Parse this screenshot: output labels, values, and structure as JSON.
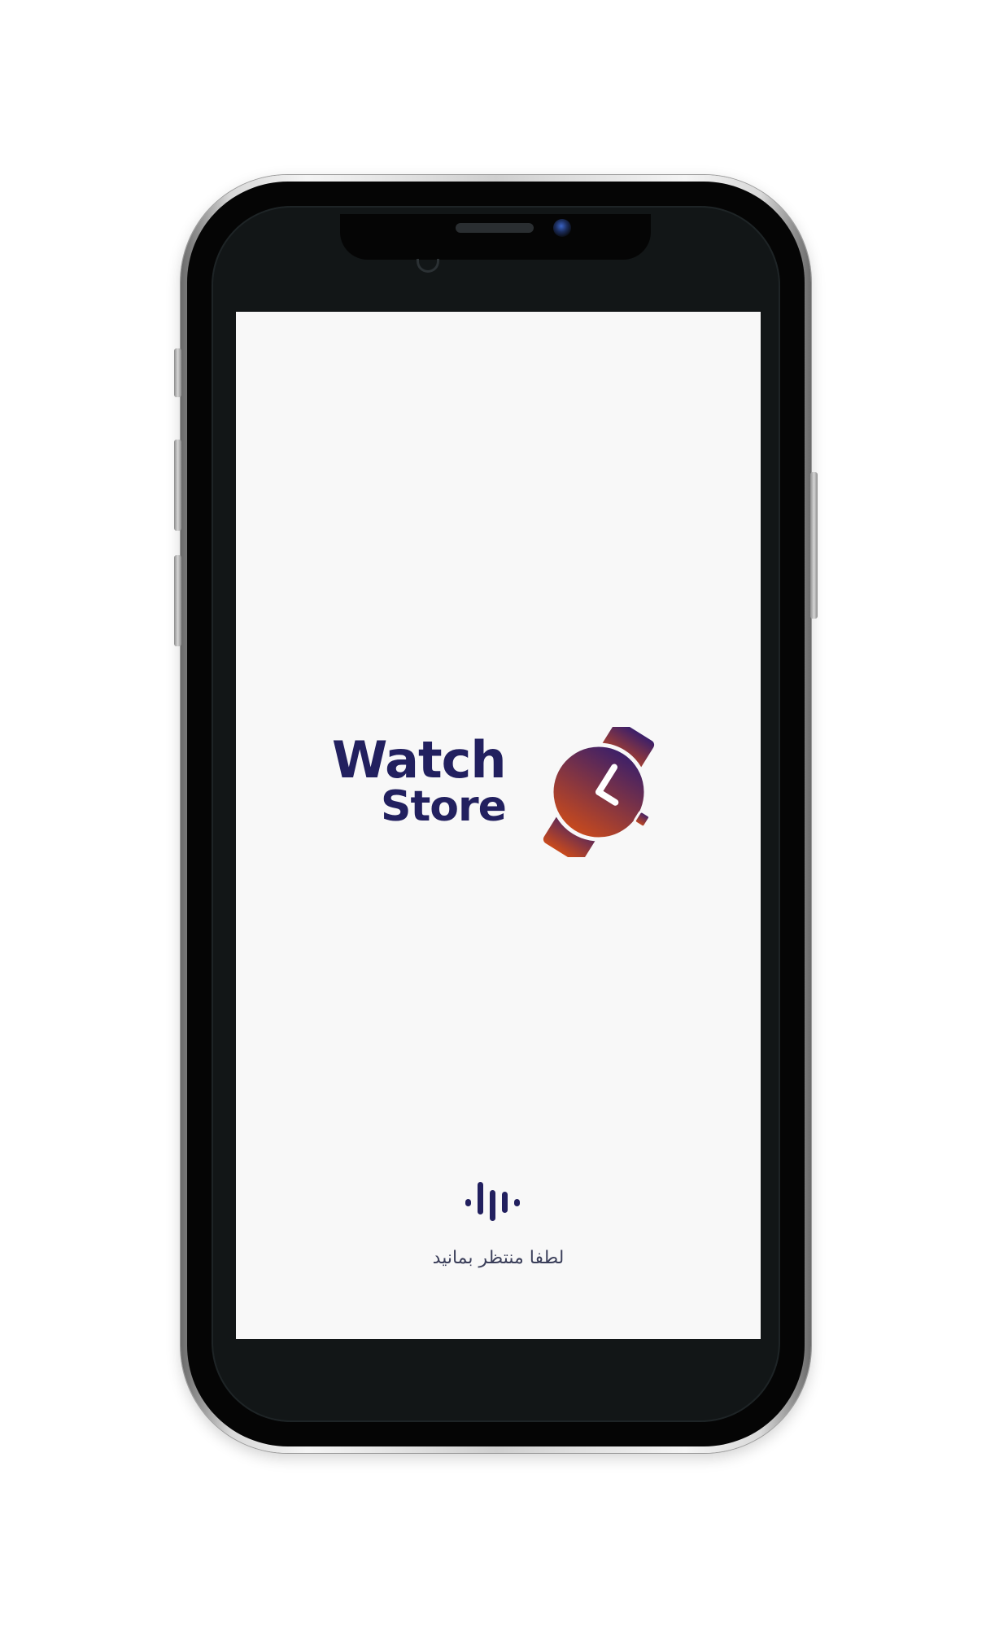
{
  "splash": {
    "logo": {
      "word_top": "Watch",
      "word_bottom": "Store",
      "icon": "watch-icon",
      "text_color": "#22205f",
      "icon_gradient": [
        "#3b1f6a",
        "#c94a1c"
      ]
    },
    "loader_icon": "audio-wave-loader-icon",
    "loading_text": "لطفا منتظر بمانید",
    "background_color": "#f8f8f8"
  }
}
